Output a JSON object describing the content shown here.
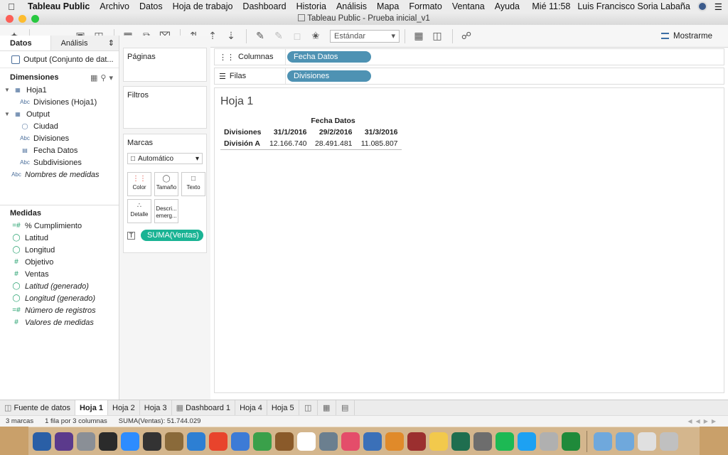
{
  "menubar": {
    "app": "Tableau Public",
    "items": [
      "Archivo",
      "Datos",
      "Hoja de trabajo",
      "Dashboard",
      "Historia",
      "Análisis",
      "Mapa",
      "Formato",
      "Ventana",
      "Ayuda"
    ],
    "clock": "Mié 11:58",
    "user": "Luis Francisco Soria Labaña"
  },
  "window": {
    "title": "Tableau Public - Prueba inicial_v1"
  },
  "toolbar": {
    "view_select": "Estándar",
    "show_me": "Mostrarme"
  },
  "datapane": {
    "tab_data": "Datos",
    "tab_analysis": "Análisis",
    "datasource": "Output (Conjunto de dat...",
    "dimensions_header": "Dimensiones",
    "dimensions": [
      {
        "label": "Hoja1",
        "type": "table",
        "indent": 0
      },
      {
        "label": "Divisiones (Hoja1)",
        "type": "Abc",
        "indent": 1
      },
      {
        "label": "Output",
        "type": "table",
        "indent": 0
      },
      {
        "label": "Ciudad",
        "type": "geo",
        "indent": 1
      },
      {
        "label": "Divisiones",
        "type": "Abc",
        "indent": 1
      },
      {
        "label": "Fecha Datos",
        "type": "date",
        "indent": 1
      },
      {
        "label": "Subdivisiones",
        "type": "Abc",
        "indent": 1
      },
      {
        "label": "Nombres de medidas",
        "type": "Abc",
        "indent": 0
      }
    ],
    "measures_header": "Medidas",
    "measures": [
      {
        "label": "% Cumplimiento",
        "type": "calc"
      },
      {
        "label": "Latitud",
        "type": "geo"
      },
      {
        "label": "Longitud",
        "type": "geo"
      },
      {
        "label": "Objetivo",
        "type": "num"
      },
      {
        "label": "Ventas",
        "type": "num"
      },
      {
        "label": "Latitud (generado)",
        "type": "geo"
      },
      {
        "label": "Longitud (generado)",
        "type": "geo"
      },
      {
        "label": "Número de registros",
        "type": "calc"
      },
      {
        "label": "Valores de medidas",
        "type": "num"
      }
    ]
  },
  "cards": {
    "pages": "Páginas",
    "filters": "Filtros",
    "marks": "Marcas",
    "mark_type": "Automático",
    "color": "Color",
    "size": "Tamaño",
    "text": "Texto",
    "detail": "Detalle",
    "tooltip_1": "Descri...",
    "tooltip_2": "emerg...",
    "text_pill": "SUMA(Ventas)"
  },
  "shelves": {
    "columns_label": "Columnas",
    "columns_pill": "Fecha Datos",
    "rows_label": "Filas",
    "rows_pill": "Divisiones"
  },
  "view": {
    "sheet_title": "Hoja 1",
    "col_field": "Fecha Datos",
    "row_field": "Divisiones",
    "columns": [
      "31/1/2016",
      "29/2/2016",
      "31/3/2016"
    ],
    "rows": [
      {
        "label": "División A",
        "values": [
          "12.166.740",
          "28.491.481",
          "11.085.807"
        ]
      }
    ]
  },
  "sheettabs": {
    "datasource": "Fuente de datos",
    "tabs": [
      "Hoja 1",
      "Hoja 2",
      "Hoja 3",
      "Dashboard 1",
      "Hoja 4",
      "Hoja 5"
    ],
    "active": "Hoja 1"
  },
  "statusbar": {
    "marks": "3 marcas",
    "dims": "1 fila por 3 columnas",
    "sum": "SUMA(Ventas): 51.744.029"
  },
  "dock_colors": [
    "#2a5fa6",
    "#5b3a8c",
    "#8a8f96",
    "#2b2b2b",
    "#2d8cff",
    "#333333",
    "#8a6a3a",
    "#2d7fd3",
    "#e8442c",
    "#3d7bd6",
    "#3aa04a",
    "#8a5a2a",
    "#ffffff",
    "#6b7f8f",
    "#e44d6a",
    "#3b70b8",
    "#e08a2a",
    "#9b2f2f",
    "#f2c94c",
    "#1f6e4f",
    "#6d6d6d",
    "#1db954",
    "#1da1f2",
    "#b0b0b0",
    "#1f8a3a",
    "#6fa8dc",
    "#6fa8dc",
    "#e0e0e0",
    "#c0c0c0"
  ]
}
